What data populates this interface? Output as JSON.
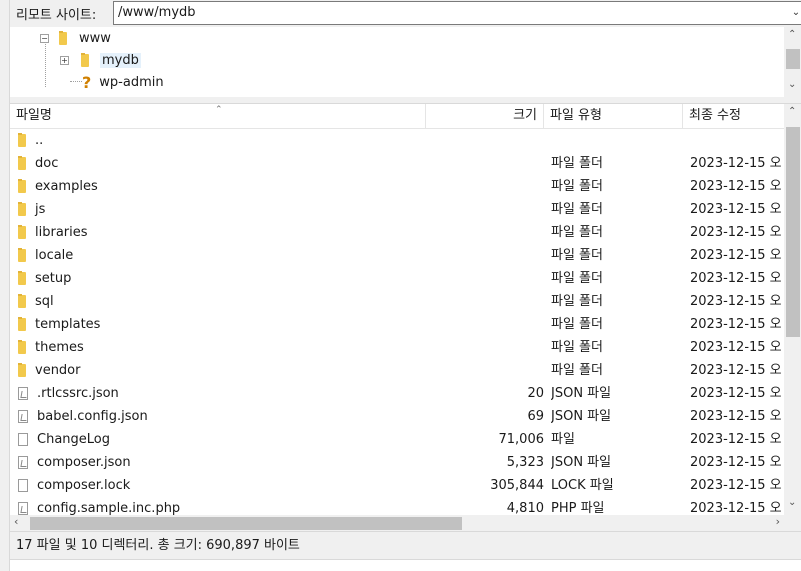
{
  "path_bar": {
    "label": "리모트 사이트:",
    "value": "/www/mydb",
    "dropdown_icon": "chevron-down-icon"
  },
  "tree": {
    "items": [
      {
        "label": "www",
        "icon": "folder-icon",
        "state": "expanded"
      },
      {
        "label": "mydb",
        "icon": "folder-icon",
        "state": "collapsed",
        "selected": true
      },
      {
        "label": "wp-admin",
        "icon": "question-icon",
        "state": "unknown"
      }
    ]
  },
  "list": {
    "columns": {
      "name": "파일명",
      "size": "크기",
      "type": "파일 유형",
      "modified": "최종 수정"
    },
    "rows": [
      {
        "name": "..",
        "size": "",
        "type": "",
        "modified": "",
        "icon": "folder"
      },
      {
        "name": "doc",
        "size": "",
        "type": "파일 폴더",
        "modified": "2023-12-15 오",
        "icon": "folder"
      },
      {
        "name": "examples",
        "size": "",
        "type": "파일 폴더",
        "modified": "2023-12-15 오",
        "icon": "folder"
      },
      {
        "name": "js",
        "size": "",
        "type": "파일 폴더",
        "modified": "2023-12-15 오",
        "icon": "folder"
      },
      {
        "name": "libraries",
        "size": "",
        "type": "파일 폴더",
        "modified": "2023-12-15 오",
        "icon": "folder"
      },
      {
        "name": "locale",
        "size": "",
        "type": "파일 폴더",
        "modified": "2023-12-15 오",
        "icon": "folder"
      },
      {
        "name": "setup",
        "size": "",
        "type": "파일 폴더",
        "modified": "2023-12-15 오",
        "icon": "folder"
      },
      {
        "name": "sql",
        "size": "",
        "type": "파일 폴더",
        "modified": "2023-12-15 오",
        "icon": "folder"
      },
      {
        "name": "templates",
        "size": "",
        "type": "파일 폴더",
        "modified": "2023-12-15 오",
        "icon": "folder"
      },
      {
        "name": "themes",
        "size": "",
        "type": "파일 폴더",
        "modified": "2023-12-15 오",
        "icon": "folder"
      },
      {
        "name": "vendor",
        "size": "",
        "type": "파일 폴더",
        "modified": "2023-12-15 오",
        "icon": "folder"
      },
      {
        "name": ".rtlcssrc.json",
        "size": "20",
        "type": "JSON 파일",
        "modified": "2023-12-15 오",
        "icon": "json"
      },
      {
        "name": "babel.config.json",
        "size": "69",
        "type": "JSON 파일",
        "modified": "2023-12-15 오",
        "icon": "json"
      },
      {
        "name": "ChangeLog",
        "size": "71,006",
        "type": "파일",
        "modified": "2023-12-15 오",
        "icon": "file"
      },
      {
        "name": "composer.json",
        "size": "5,323",
        "type": "JSON 파일",
        "modified": "2023-12-15 오",
        "icon": "json"
      },
      {
        "name": "composer.lock",
        "size": "305,844",
        "type": "LOCK 파일",
        "modified": "2023-12-15 오",
        "icon": "file"
      },
      {
        "name": "config.sample.inc.php",
        "size": "4,810",
        "type": "PHP 파일",
        "modified": "2023-12-15 오",
        "icon": "json"
      }
    ]
  },
  "status": {
    "text": "17 파일 및 10 디렉터리. 총 크기: 690,897 바이트"
  }
}
